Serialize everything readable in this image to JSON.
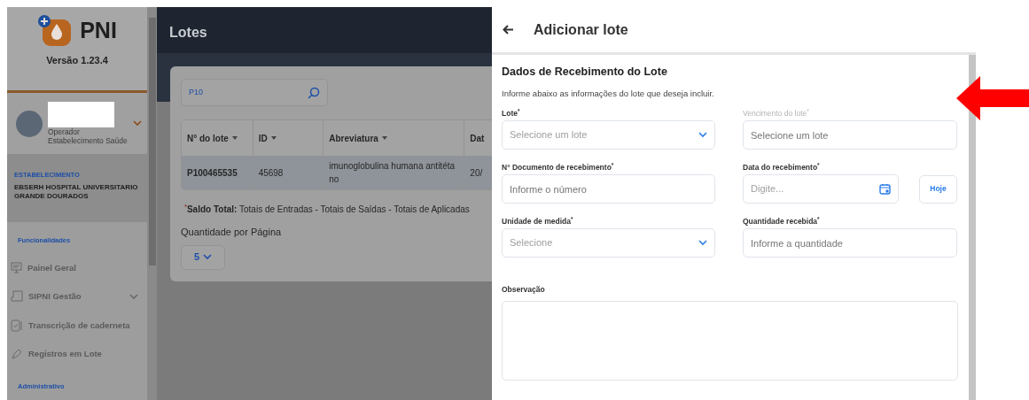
{
  "sidebar": {
    "app_name": "PNI",
    "version": "Versão 1.23.4",
    "user": {
      "role": "Operador",
      "profile": "Estabelecimento Saúde"
    },
    "establishment": {
      "label": "ESTABELECIMENTO",
      "name": "EBSERH HOSPITAL UNIVERSITARIO GRANDE DOURADOS"
    },
    "sections": [
      {
        "title": "Funcionalidades",
        "items": [
          {
            "label": "Painel Geral",
            "kind": "link"
          },
          {
            "label": "SIPNI Gestão",
            "kind": "group",
            "expanded": false
          },
          {
            "label": "Transcrição de caderneta",
            "kind": "link"
          },
          {
            "label": "Registros em Lote",
            "kind": "link"
          }
        ]
      },
      {
        "title": "Administrativo"
      }
    ]
  },
  "main": {
    "title": "Lotes",
    "search": {
      "value": "P10"
    },
    "table": {
      "columns": [
        {
          "label": "N° do lote",
          "sortable": true
        },
        {
          "label": "ID",
          "sortable": true
        },
        {
          "label": "Abreviatura",
          "sortable": true
        },
        {
          "label": "Dat",
          "sortable": false
        }
      ],
      "rows": [
        [
          "P100465535",
          "45698",
          "imunoglobulina humana antitéta no",
          "20/"
        ]
      ]
    },
    "note": "$^{*}$**Saldo Total:** Totais de Entradas - Totais de Saídas - Totais de Aplicadas",
    "page_size": {
      "label": "Quantidade por Página",
      "value": "5"
    }
  },
  "drawer": {
    "title": "Adicionar lote",
    "section_title": "Dados de Recebimento do Lote",
    "description": "Informe abaixo as informações do lote que deseja incluir.",
    "fields": [
      {
        "label": "Lote$^{*}$",
        "kind": "select",
        "placeholder": "Selecione um lote",
        "disabled": false
      },
      {
        "label": "Vencimento do lote$^{*}$",
        "kind": "input",
        "placeholder": "Selecione um lote",
        "disabled": true
      },
      {
        "label": "N° Documento de recebimento$^{*}$",
        "kind": "input",
        "placeholder": "Informe o número",
        "disabled": false
      },
      {
        "label": "Data do recebimento$^{*}$",
        "kind": "date",
        "placeholder": "Digite...",
        "disabled": false,
        "button": "Hoje"
      },
      {
        "label": "Unidade de medida$^{*}$",
        "kind": "select",
        "placeholder": "Selecione",
        "disabled": false
      },
      {
        "label": "Quantidade recebida$^{*}$",
        "kind": "input",
        "placeholder": "Informe a quantidade",
        "disabled": false
      }
    ],
    "observation": {
      "label": "Observação"
    }
  }
}
